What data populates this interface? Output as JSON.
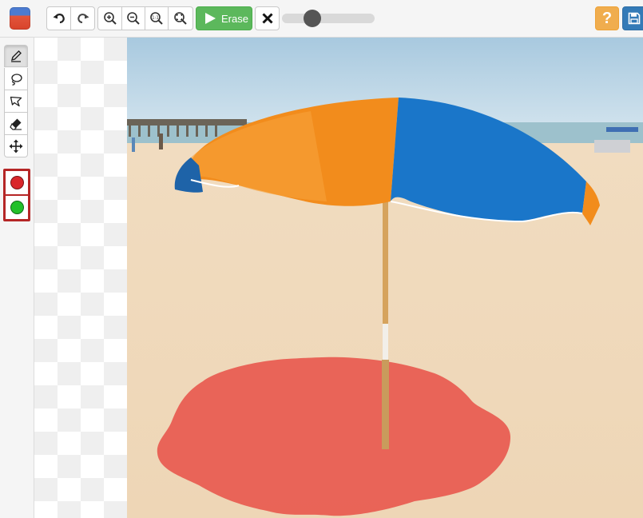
{
  "toolbar": {
    "logo_icon": "app-logo-icon",
    "undo_icon": "undo-icon",
    "redo_icon": "redo-icon",
    "zoom_in_icon": "zoom-in-icon",
    "zoom_out_icon": "zoom-out-icon",
    "zoom_actual_icon": "zoom-actual-size-icon",
    "zoom_fit_icon": "zoom-fit-icon",
    "erase_label": "Erase",
    "erase_icon": "play-icon",
    "cancel_icon": "close-icon",
    "brush_size_level": 0.33,
    "help_label": "?",
    "save_icon": "floppy-disk-icon"
  },
  "tools": [
    {
      "name": "pencil",
      "icon": "pencil-icon",
      "active": true
    },
    {
      "name": "lasso",
      "icon": "lasso-icon",
      "active": false
    },
    {
      "name": "polygon",
      "icon": "polygon-lasso-icon",
      "active": false
    },
    {
      "name": "eraser",
      "icon": "eraser-icon",
      "active": false
    },
    {
      "name": "move",
      "icon": "move-arrows-icon",
      "active": false
    }
  ],
  "colors": {
    "remove": "#d9262a",
    "keep": "#22c02a",
    "selection_outline": "#b52626"
  },
  "canvas": {
    "image": "beach-umbrella-photo",
    "mask_color": "#e85a4f"
  }
}
